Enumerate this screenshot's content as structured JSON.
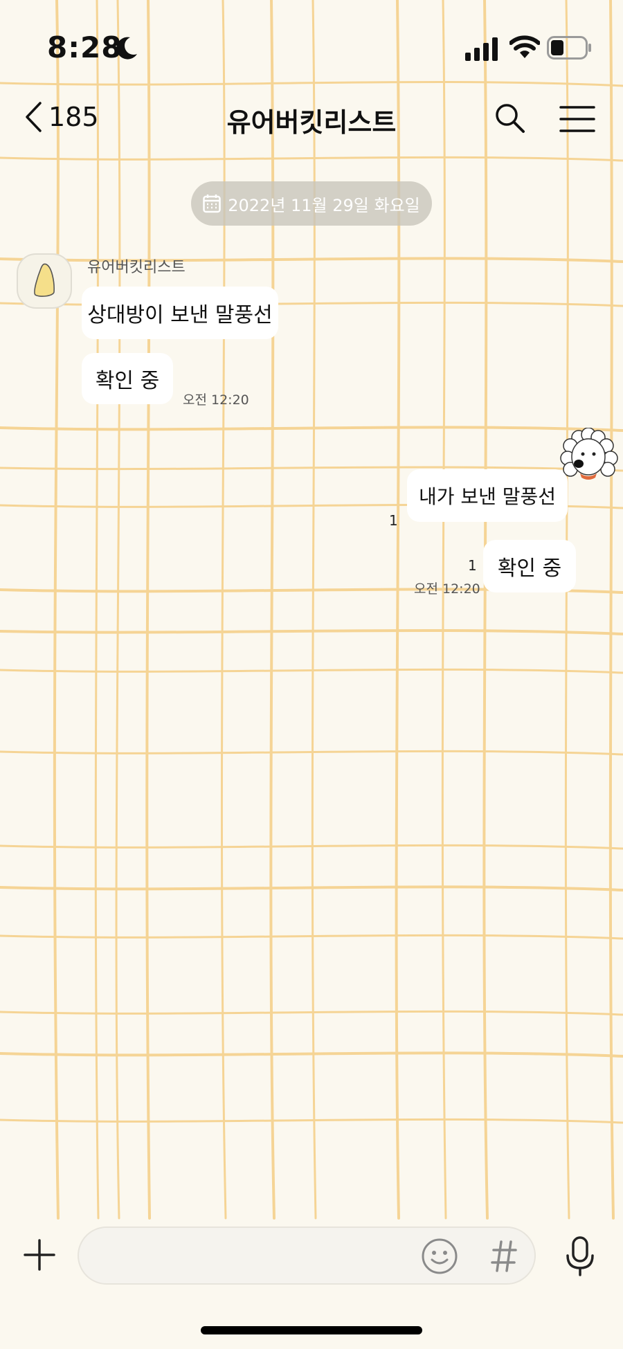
{
  "status_bar": {
    "time": "8:28"
  },
  "header": {
    "back_count": "185",
    "title": "유어버킷리스트"
  },
  "date_divider": "2022년 11월 29일 화요일",
  "messages": {
    "incoming": {
      "sender": "유어버킷리스트",
      "bubbles": [
        "상대방이 보낸 말풍선",
        "확인 중"
      ],
      "time": "오전 12:20"
    },
    "outgoing": {
      "bubbles": [
        "내가 보낸 말풍선",
        "확인 중"
      ],
      "unread_counts": [
        "1",
        "1"
      ],
      "time": "오전 12:20"
    }
  },
  "input": {
    "value": "",
    "placeholder": ""
  },
  "icons": {
    "moon": "moon-icon",
    "signal": "signal-icon",
    "wifi": "wifi-icon",
    "battery": "battery-icon",
    "back": "chevron-left-icon",
    "search": "search-icon",
    "menu": "menu-icon",
    "calendar": "calendar-icon",
    "plus": "plus-icon",
    "emoji": "emoji-icon",
    "hash": "hash-icon",
    "mic": "mic-icon"
  },
  "colors": {
    "background": "#fbf8ef",
    "grid_line": "#f4c978",
    "bubble": "#ffffff",
    "date_pill": "#c8c4ba"
  }
}
